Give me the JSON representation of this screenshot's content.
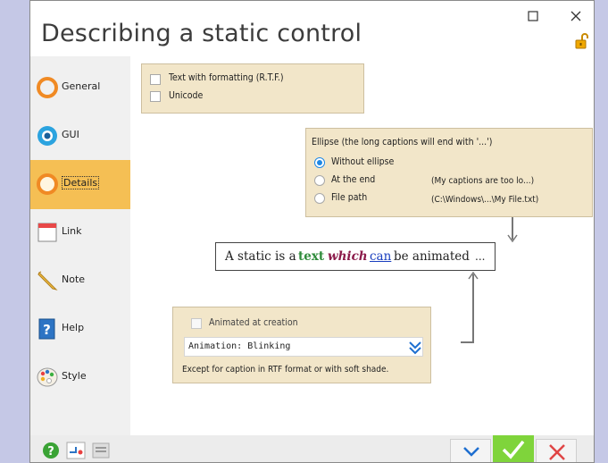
{
  "window": {
    "title": "Describing a static control",
    "maximize_icon": "maximize-icon",
    "close_icon": "close-icon",
    "lock_icon": "unlocked-padlock-icon"
  },
  "sidebar": {
    "items": [
      {
        "label": "General",
        "icon": "ring-icon",
        "active": false
      },
      {
        "label": "GUI",
        "icon": "eye-icon",
        "active": false
      },
      {
        "label": "Details",
        "icon": "ring-icon",
        "active": true
      },
      {
        "label": "Link",
        "icon": "window-icon",
        "active": false
      },
      {
        "label": "Note",
        "icon": "pencil-icon",
        "active": false
      },
      {
        "label": "Help",
        "icon": "help-book-icon",
        "active": false
      },
      {
        "label": "Style",
        "icon": "palette-icon",
        "active": false
      }
    ]
  },
  "format_panel": {
    "rtf_label": "Text with formatting (R.T.F.)",
    "unicode_label": "Unicode"
  },
  "ellipse_panel": {
    "title": "Ellipse (the long captions will end with '...')",
    "options": [
      {
        "label": "Without ellipse",
        "example": "",
        "selected": true
      },
      {
        "label": "At the end",
        "example": "(My captions are too lo...)",
        "selected": false
      },
      {
        "label": "File path",
        "example": "(C:\\Windows\\...\\My File.txt)",
        "selected": false
      }
    ]
  },
  "preview": {
    "part1": "A static is a ",
    "part2": "text",
    "part3": " ",
    "part4": "which",
    "part5": " ",
    "part6": "can",
    "part7": " be animated",
    "ellipsis": "...",
    "colors": {
      "text": "#2e8b3a",
      "which": "#8b1a4a",
      "can": "#1a3fbf"
    }
  },
  "animation_panel": {
    "checkbox_label": "Animated at creation",
    "select_value": "Animation: Blinking",
    "note": "Except for caption in RTF format or with soft shade."
  },
  "bottom_bar": {
    "left_icons": [
      "help-icon",
      "tab-order-icon",
      "preview-icon"
    ],
    "down_icon": "chevron-down-icon",
    "ok_icon": "checkmark-icon",
    "cancel_icon": "cross-icon"
  },
  "colors": {
    "accent": "#f5bf54",
    "panel": "#f2e6c9",
    "ok": "#7fd43b",
    "cancel": "#e04545",
    "blue": "#1e88e5"
  }
}
